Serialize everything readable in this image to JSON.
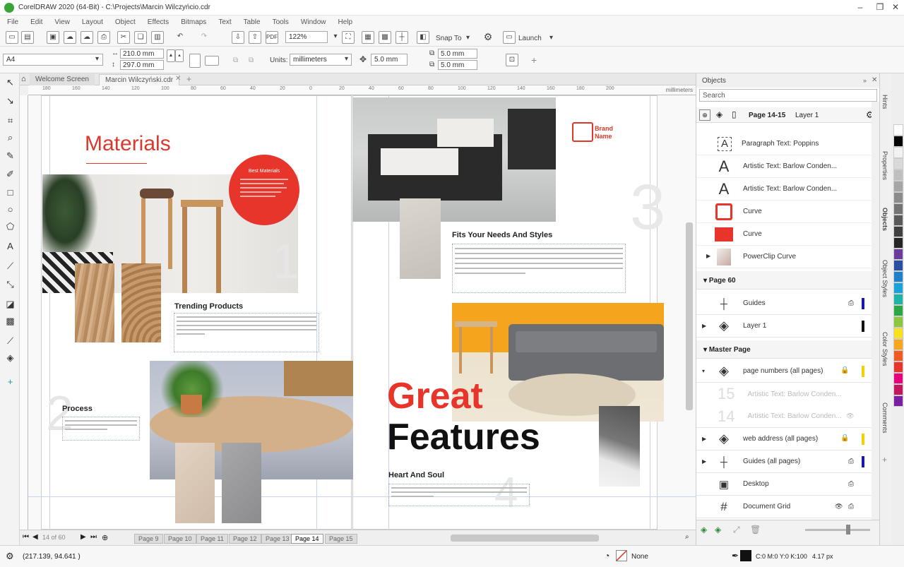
{
  "app": {
    "title": "CorelDRAW 2020 (64-Bit) - C:\\Projects\\Marcin Wilczyńcio.cdr"
  },
  "menu": [
    "File",
    "Edit",
    "View",
    "Layout",
    "Object",
    "Effects",
    "Bitmaps",
    "Text",
    "Table",
    "Tools",
    "Window",
    "Help"
  ],
  "toolbar": {
    "zoom": "122%",
    "snap": "Snap To",
    "launch": "Launch"
  },
  "propbar": {
    "page_size": "A4",
    "width": "210.0 mm",
    "height": "297.0 mm",
    "units_label": "Units:",
    "units": "millimeters",
    "nudge": "5.0 mm",
    "dup_x": "5.0 mm",
    "dup_y": "5.0 mm"
  },
  "doc_tabs": [
    "Welcome Screen",
    "Marcin Wilczyński.cdr"
  ],
  "ruler_label": "millimeters",
  "ruler_ticks": [
    "180",
    "160",
    "140",
    "120",
    "100",
    "80",
    "60",
    "40",
    "20",
    "0",
    "20",
    "40",
    "60",
    "80",
    "100",
    "120",
    "140",
    "160",
    "180",
    "200"
  ],
  "page_content": {
    "materials_title": "Materials",
    "best_materials": "Best Materials",
    "trending_heading": "Trending Products",
    "process_heading": "Process",
    "fits_heading": "Fits Your Needs And Styles",
    "brand_name": "Brand Name",
    "great": "Great",
    "features": "Features",
    "heart_heading": "Heart And Soul",
    "page_numbers": [
      "1",
      "2",
      "3",
      "4"
    ]
  },
  "page_bar": {
    "counter": "14 of 60",
    "tabs": [
      "Page 9",
      "Page 10",
      "Page 11",
      "Page 12",
      "Page 13",
      "Page 14",
      "Page 15"
    ],
    "active": "Page 14"
  },
  "status": {
    "coords": "(217.139, 94.641 )",
    "fill": "None",
    "color_model": "C:0 M:0 Y:0 K:100",
    "outline": "4.17 px"
  },
  "objects_panel": {
    "title": "Objects",
    "search_placeholder": "Search",
    "header_page": "Page 14-15",
    "header_layer": "Layer 1",
    "items": [
      {
        "label": "Paragraph Text: Poppins",
        "icon": "paragraph-text-icon"
      },
      {
        "label": "Artistic Text: Barlow Conden...",
        "icon": "artistic-text-icon"
      },
      {
        "label": "Artistic Text: Barlow Conden...",
        "icon": "artistic-text-icon"
      },
      {
        "label": "Curve",
        "icon": "curve-logo-icon"
      },
      {
        "label": "Curve",
        "icon": "curve-red-icon"
      },
      {
        "label": "PowerClip Curve",
        "icon": "powerclip-icon"
      }
    ],
    "page60": "Page 60",
    "page60_rows": [
      "Guides",
      "Layer 1"
    ],
    "master_page": "Master Page",
    "master_rows": [
      {
        "label": "page numbers (all pages)",
        "color": "#f5d000"
      },
      {
        "label": "Artistic Text: Barlow Conden...",
        "color": ""
      },
      {
        "label": "Artistic Text: Barlow Conden...",
        "color": ""
      },
      {
        "label": "web address (all pages)",
        "color": "#f5d000"
      },
      {
        "label": "Guides (all pages)",
        "color": "#1a1aa8"
      },
      {
        "label": "Desktop",
        "color": ""
      },
      {
        "label": "Document Grid",
        "color": ""
      }
    ],
    "ghost_numbers": [
      "15",
      "14"
    ]
  },
  "side_tabs": [
    "Hints",
    "Properties",
    "Objects",
    "Object Styles",
    "Color Styles",
    "Comments"
  ],
  "colors": {
    "accent_red": "#e8352b",
    "title_red": "#d93a2b"
  },
  "palette": [
    "#ffffff",
    "#000000",
    "#f2f2f2",
    "#d9d9d9",
    "#bfbfbf",
    "#a6a6a6",
    "#8c8c8c",
    "#737373",
    "#595959",
    "#404040",
    "#262626",
    "#6a3d9a",
    "#2b4fa0",
    "#1f7fc8",
    "#19a3d8",
    "#1db3a6",
    "#29a843",
    "#8cc63f",
    "#f7e01d",
    "#f7a51d",
    "#f05a23",
    "#e8352b",
    "#e6007e",
    "#c2185b",
    "#7b1fa2"
  ]
}
